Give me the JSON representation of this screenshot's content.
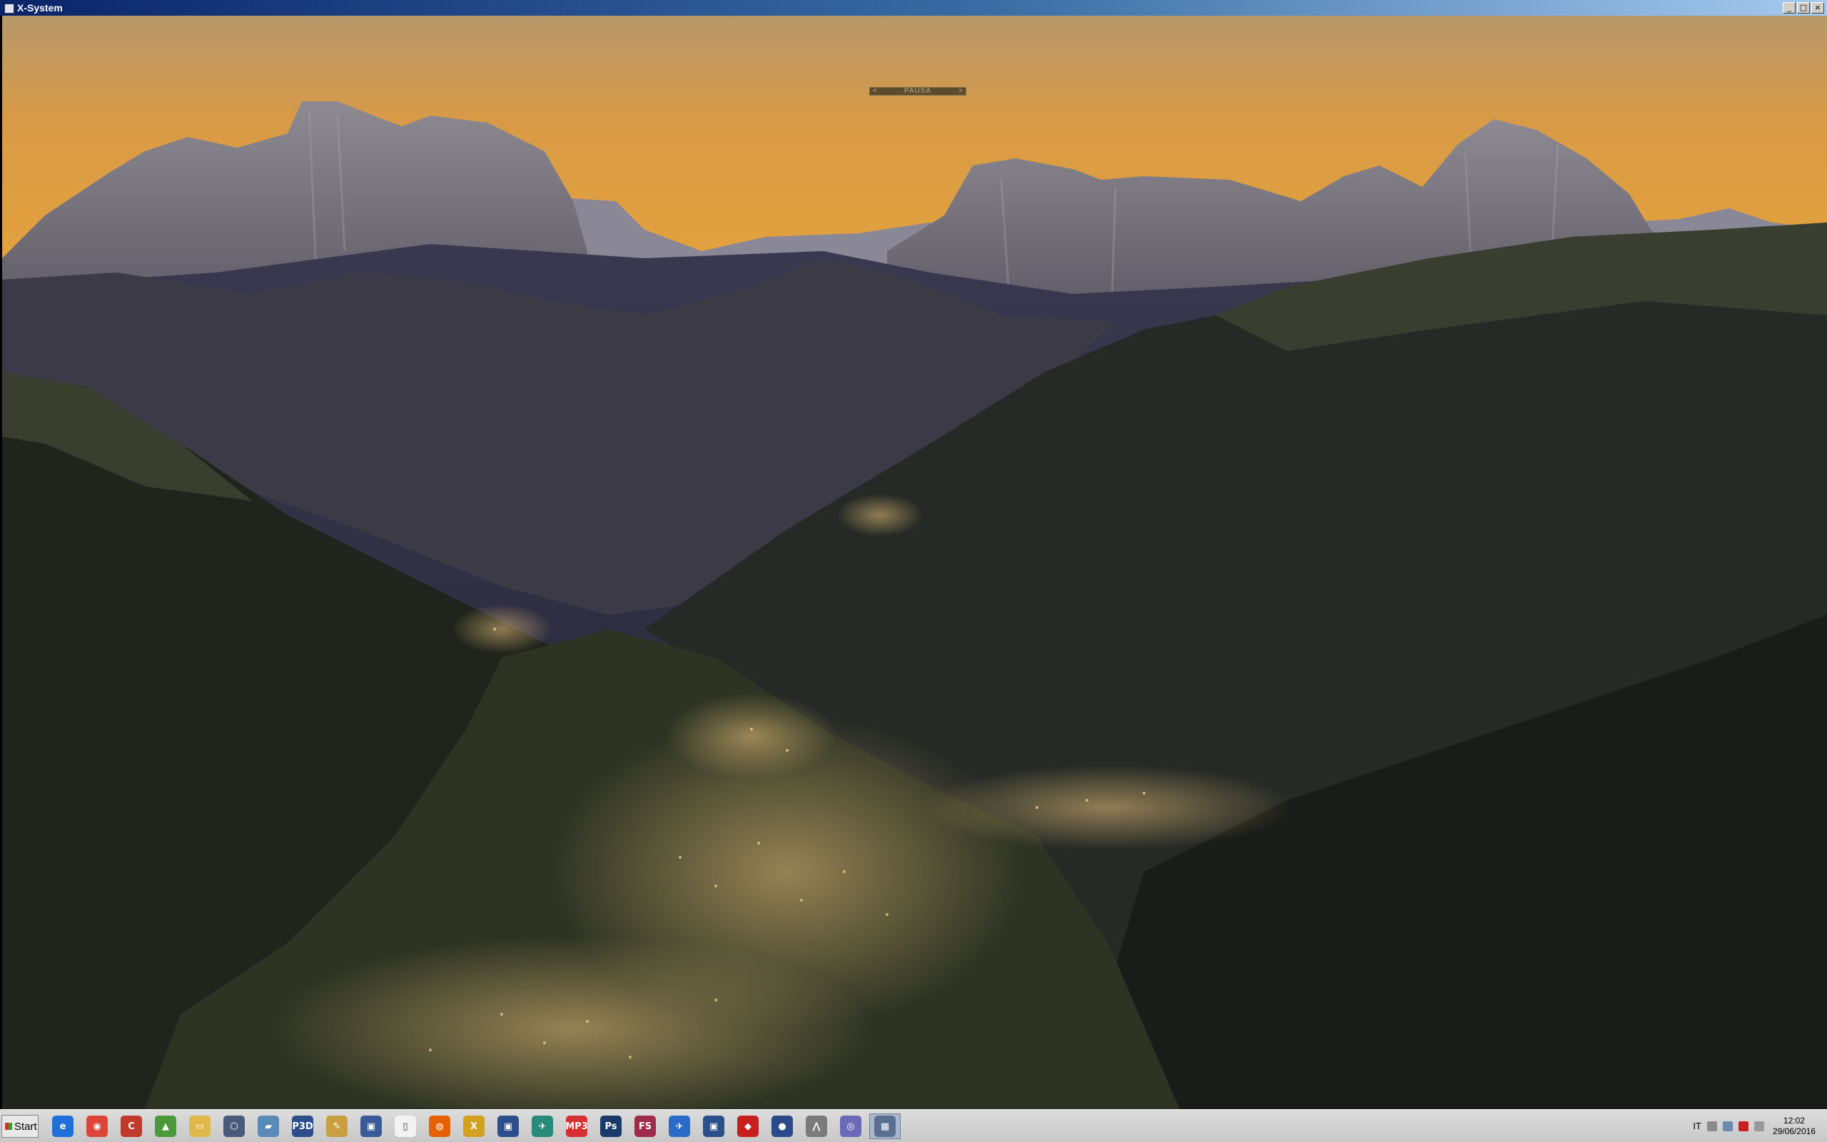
{
  "window": {
    "title": "X-System",
    "controls": [
      "_",
      "□",
      "×"
    ]
  },
  "sim": {
    "pause_left": "<",
    "pause_label": "PAUSA",
    "pause_right": ">"
  },
  "taskbar": {
    "start_label": "Start",
    "icons": [
      {
        "name": "internet-explorer-icon",
        "color": "#1e6fd9",
        "glyph": "e"
      },
      {
        "name": "chrome-icon",
        "color": "#db4437",
        "glyph": "◉"
      },
      {
        "name": "ccleaner-icon",
        "color": "#c0392b",
        "glyph": "C"
      },
      {
        "name": "pin-icon",
        "color": "#4a9a3a",
        "glyph": "▲"
      },
      {
        "name": "folder-icon",
        "color": "#e0b84a",
        "glyph": "▭"
      },
      {
        "name": "network-icon",
        "color": "#4a5a7a",
        "glyph": "⬡"
      },
      {
        "name": "book-icon",
        "color": "#5a8ab8",
        "glyph": "▰"
      },
      {
        "name": "p3d-icon",
        "color": "#2c4f8c",
        "glyph": "P3D"
      },
      {
        "name": "paint-icon",
        "color": "#c8a040",
        "glyph": "✎"
      },
      {
        "name": "app-window-icon",
        "color": "#3a5a9a",
        "glyph": "▣"
      },
      {
        "name": "document-icon",
        "color": "#f2f2f2",
        "glyph": "▯"
      },
      {
        "name": "firefox-icon",
        "color": "#e66000",
        "glyph": "◍"
      },
      {
        "name": "xplane-icon",
        "color": "#d4a020",
        "glyph": "X"
      },
      {
        "name": "app-window-icon-2",
        "color": "#2c4f8c",
        "glyph": "▣"
      },
      {
        "name": "airplane-icon",
        "color": "#2a8a7a",
        "glyph": "✈"
      },
      {
        "name": "mp3-icon",
        "color": "#d83030",
        "glyph": "MP3"
      },
      {
        "name": "photoshop-icon",
        "color": "#1a3a6a",
        "glyph": "Ps"
      },
      {
        "name": "fs-icon",
        "color": "#a02a4a",
        "glyph": "FS"
      },
      {
        "name": "plane-icon",
        "color": "#2a6ac8",
        "glyph": "✈"
      },
      {
        "name": "app-window-icon-3",
        "color": "#2c4f8c",
        "glyph": "▣"
      },
      {
        "name": "flame-icon",
        "color": "#c81e1e",
        "glyph": "◆"
      },
      {
        "name": "globe-icon",
        "color": "#2a4a8a",
        "glyph": "●"
      },
      {
        "name": "tool-icon",
        "color": "#7a7a7a",
        "glyph": "⋀"
      },
      {
        "name": "spiral-icon",
        "color": "#6a6ab8",
        "glyph": "◎"
      },
      {
        "name": "xsystem-window-icon",
        "color": "#5a7090",
        "glyph": "▦",
        "active": true
      }
    ],
    "tray": {
      "language": "IT",
      "time": "12:02",
      "date": "29/06/2016"
    }
  }
}
